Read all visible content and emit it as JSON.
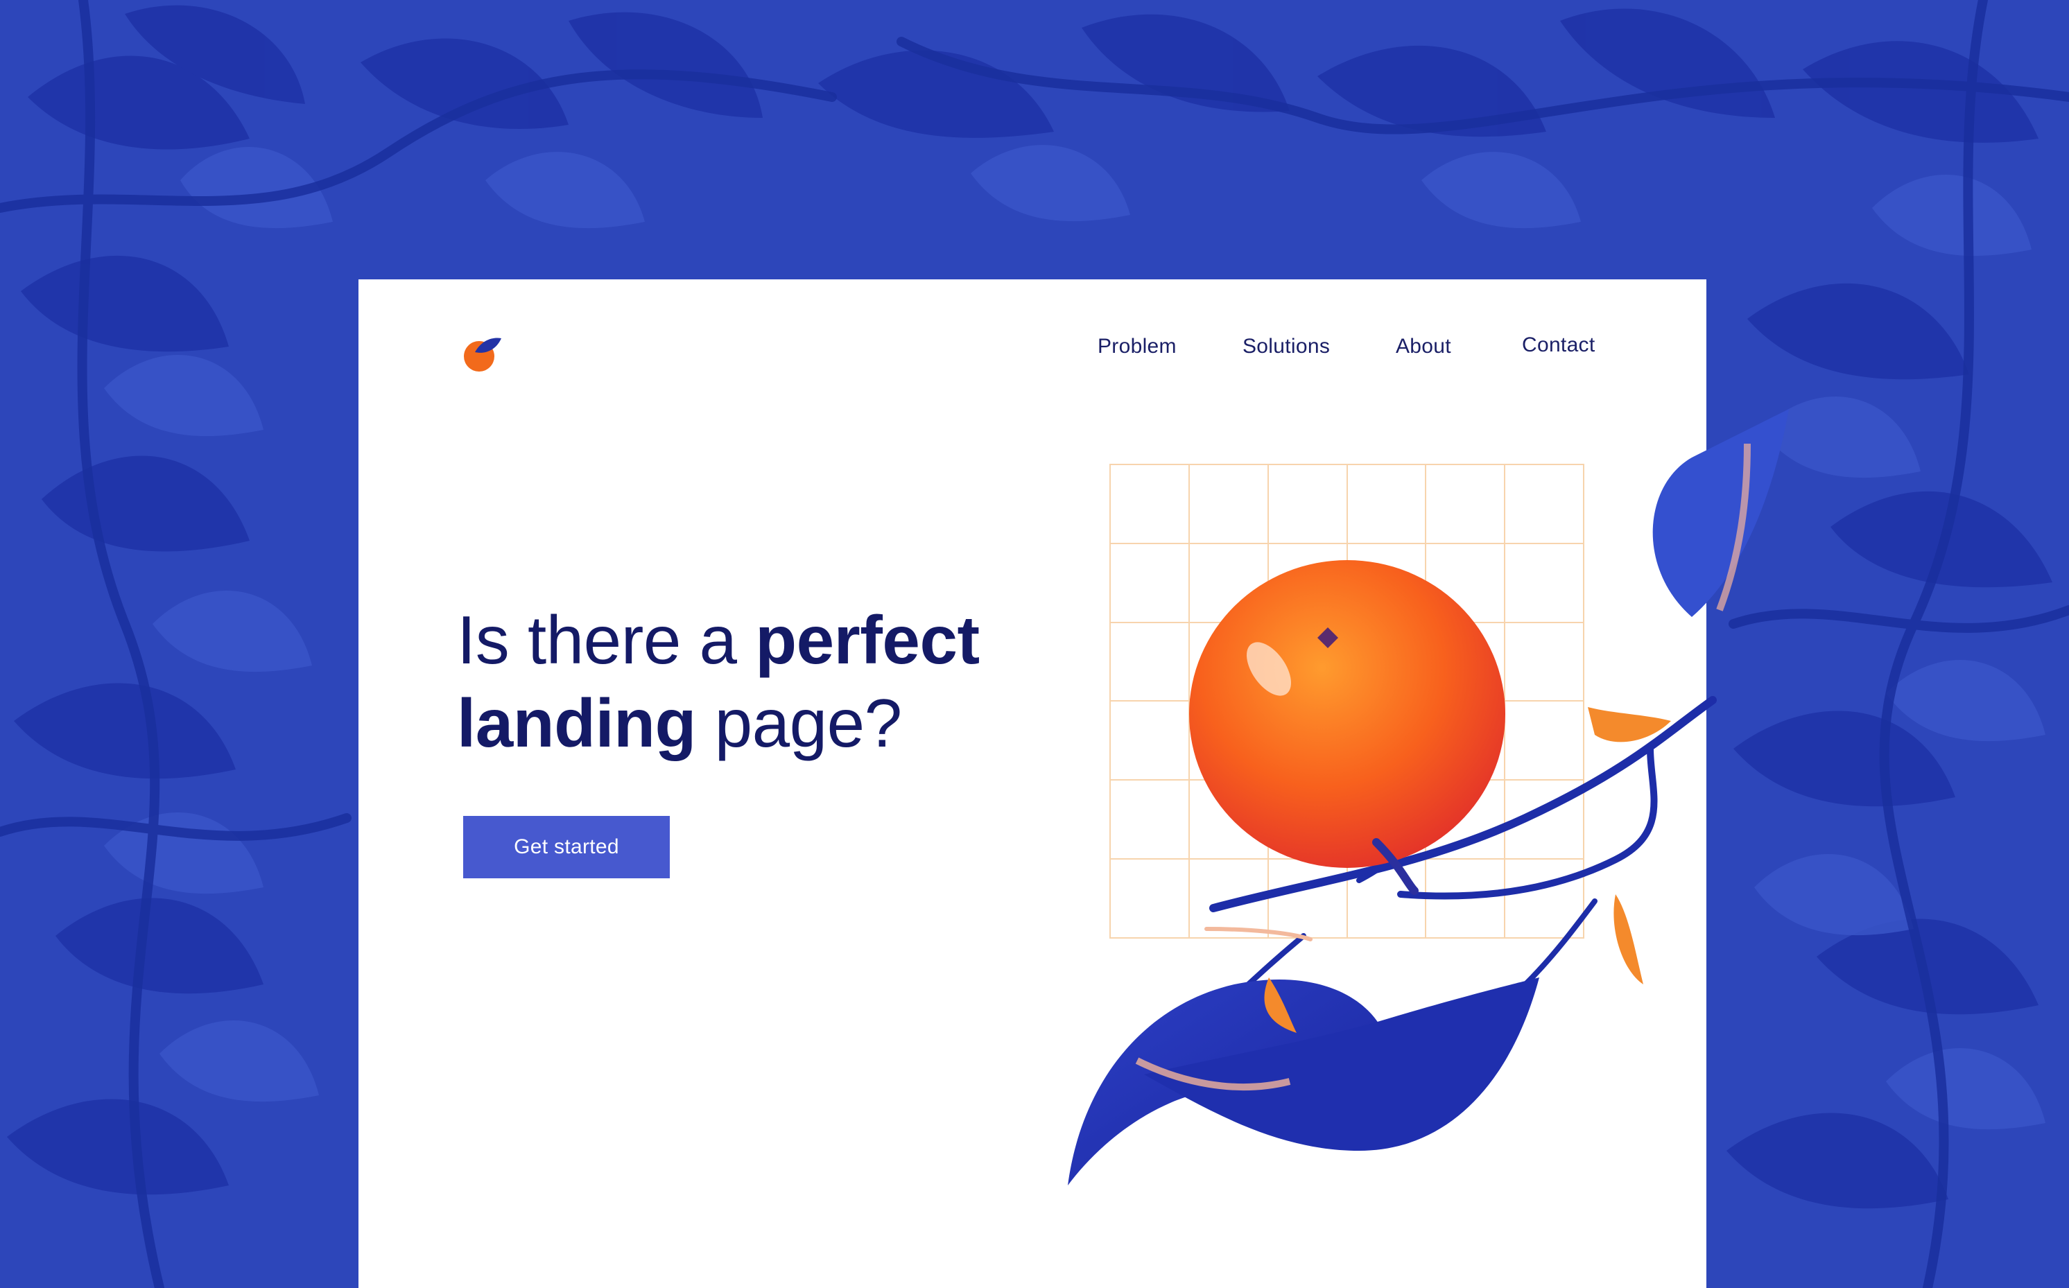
{
  "colors": {
    "background": "#2c45b8",
    "card": "#ffffff",
    "text_dark": "#141a66",
    "cta": "#4759cf",
    "accent_orange": "#f26a1b",
    "grid": "#f7d4ad"
  },
  "logo": {
    "icon": "orange-leaf-logo"
  },
  "nav": {
    "items": [
      {
        "label": "Problem"
      },
      {
        "label": "Solutions"
      },
      {
        "label": "About"
      },
      {
        "label": "Contact"
      }
    ]
  },
  "hero": {
    "title_regular_1": "Is there a",
    "title_bold_1": "perfect",
    "title_bold_2": "landing",
    "title_regular_2": "page?",
    "cta_label": "Get started"
  },
  "illustration": {
    "subject": "orange-on-branch-illustration",
    "background": "blue-leaf-pattern"
  }
}
